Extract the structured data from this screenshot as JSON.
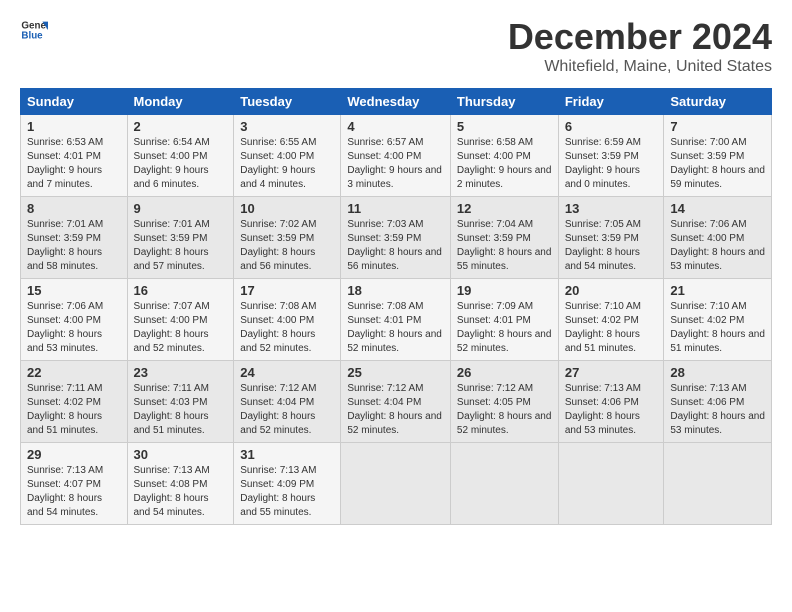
{
  "logo": {
    "general": "General",
    "blue": "Blue"
  },
  "title": {
    "month": "December 2024",
    "location": "Whitefield, Maine, United States"
  },
  "weekdays": [
    "Sunday",
    "Monday",
    "Tuesday",
    "Wednesday",
    "Thursday",
    "Friday",
    "Saturday"
  ],
  "weeks": [
    [
      {
        "day": "1",
        "sunrise": "6:53 AM",
        "sunset": "4:01 PM",
        "daylight": "9 hours and 7 minutes."
      },
      {
        "day": "2",
        "sunrise": "6:54 AM",
        "sunset": "4:00 PM",
        "daylight": "9 hours and 6 minutes."
      },
      {
        "day": "3",
        "sunrise": "6:55 AM",
        "sunset": "4:00 PM",
        "daylight": "9 hours and 4 minutes."
      },
      {
        "day": "4",
        "sunrise": "6:57 AM",
        "sunset": "4:00 PM",
        "daylight": "9 hours and 3 minutes."
      },
      {
        "day": "5",
        "sunrise": "6:58 AM",
        "sunset": "4:00 PM",
        "daylight": "9 hours and 2 minutes."
      },
      {
        "day": "6",
        "sunrise": "6:59 AM",
        "sunset": "3:59 PM",
        "daylight": "9 hours and 0 minutes."
      },
      {
        "day": "7",
        "sunrise": "7:00 AM",
        "sunset": "3:59 PM",
        "daylight": "8 hours and 59 minutes."
      }
    ],
    [
      {
        "day": "8",
        "sunrise": "7:01 AM",
        "sunset": "3:59 PM",
        "daylight": "8 hours and 58 minutes."
      },
      {
        "day": "9",
        "sunrise": "7:01 AM",
        "sunset": "3:59 PM",
        "daylight": "8 hours and 57 minutes."
      },
      {
        "day": "10",
        "sunrise": "7:02 AM",
        "sunset": "3:59 PM",
        "daylight": "8 hours and 56 minutes."
      },
      {
        "day": "11",
        "sunrise": "7:03 AM",
        "sunset": "3:59 PM",
        "daylight": "8 hours and 56 minutes."
      },
      {
        "day": "12",
        "sunrise": "7:04 AM",
        "sunset": "3:59 PM",
        "daylight": "8 hours and 55 minutes."
      },
      {
        "day": "13",
        "sunrise": "7:05 AM",
        "sunset": "3:59 PM",
        "daylight": "8 hours and 54 minutes."
      },
      {
        "day": "14",
        "sunrise": "7:06 AM",
        "sunset": "4:00 PM",
        "daylight": "8 hours and 53 minutes."
      }
    ],
    [
      {
        "day": "15",
        "sunrise": "7:06 AM",
        "sunset": "4:00 PM",
        "daylight": "8 hours and 53 minutes."
      },
      {
        "day": "16",
        "sunrise": "7:07 AM",
        "sunset": "4:00 PM",
        "daylight": "8 hours and 52 minutes."
      },
      {
        "day": "17",
        "sunrise": "7:08 AM",
        "sunset": "4:00 PM",
        "daylight": "8 hours and 52 minutes."
      },
      {
        "day": "18",
        "sunrise": "7:08 AM",
        "sunset": "4:01 PM",
        "daylight": "8 hours and 52 minutes."
      },
      {
        "day": "19",
        "sunrise": "7:09 AM",
        "sunset": "4:01 PM",
        "daylight": "8 hours and 52 minutes."
      },
      {
        "day": "20",
        "sunrise": "7:10 AM",
        "sunset": "4:02 PM",
        "daylight": "8 hours and 51 minutes."
      },
      {
        "day": "21",
        "sunrise": "7:10 AM",
        "sunset": "4:02 PM",
        "daylight": "8 hours and 51 minutes."
      }
    ],
    [
      {
        "day": "22",
        "sunrise": "7:11 AM",
        "sunset": "4:02 PM",
        "daylight": "8 hours and 51 minutes."
      },
      {
        "day": "23",
        "sunrise": "7:11 AM",
        "sunset": "4:03 PM",
        "daylight": "8 hours and 51 minutes."
      },
      {
        "day": "24",
        "sunrise": "7:12 AM",
        "sunset": "4:04 PM",
        "daylight": "8 hours and 52 minutes."
      },
      {
        "day": "25",
        "sunrise": "7:12 AM",
        "sunset": "4:04 PM",
        "daylight": "8 hours and 52 minutes."
      },
      {
        "day": "26",
        "sunrise": "7:12 AM",
        "sunset": "4:05 PM",
        "daylight": "8 hours and 52 minutes."
      },
      {
        "day": "27",
        "sunrise": "7:13 AM",
        "sunset": "4:06 PM",
        "daylight": "8 hours and 53 minutes."
      },
      {
        "day": "28",
        "sunrise": "7:13 AM",
        "sunset": "4:06 PM",
        "daylight": "8 hours and 53 minutes."
      }
    ],
    [
      {
        "day": "29",
        "sunrise": "7:13 AM",
        "sunset": "4:07 PM",
        "daylight": "8 hours and 54 minutes."
      },
      {
        "day": "30",
        "sunrise": "7:13 AM",
        "sunset": "4:08 PM",
        "daylight": "8 hours and 54 minutes."
      },
      {
        "day": "31",
        "sunrise": "7:13 AM",
        "sunset": "4:09 PM",
        "daylight": "8 hours and 55 minutes."
      },
      null,
      null,
      null,
      null
    ]
  ]
}
